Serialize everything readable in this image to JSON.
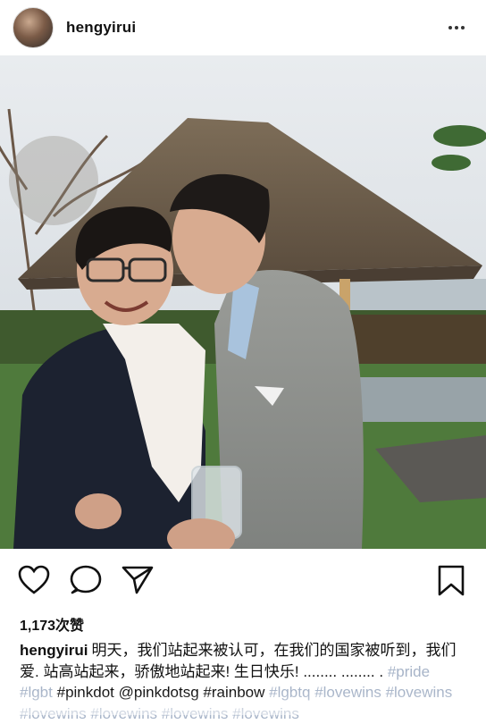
{
  "post": {
    "username": "hengyirui",
    "likes_text": "1,173次赞",
    "caption": {
      "username": "hengyirui",
      "text_1": "明天，我们站起来被认可，在我们的国家被听到，我们爱. 站高站起来，骄傲地站起来! 生日快乐! ........ ........ .",
      "tags": [
        "#pride",
        "#lgbt",
        "#pinkdot",
        "@pinkdotsg",
        "#rainbow",
        "#lgbtq",
        "#lovewins",
        "#lovewins",
        "#lovewins",
        "#lovewins",
        "#lovewins",
        "#lovewins"
      ]
    }
  },
  "icons": {
    "more": "more-dots-icon",
    "like": "heart-icon",
    "comment": "comment-bubble-icon",
    "share": "paper-plane-icon",
    "save": "bookmark-icon"
  },
  "colors": {
    "hashtag": "#a7b4c8",
    "text": "#111111"
  }
}
